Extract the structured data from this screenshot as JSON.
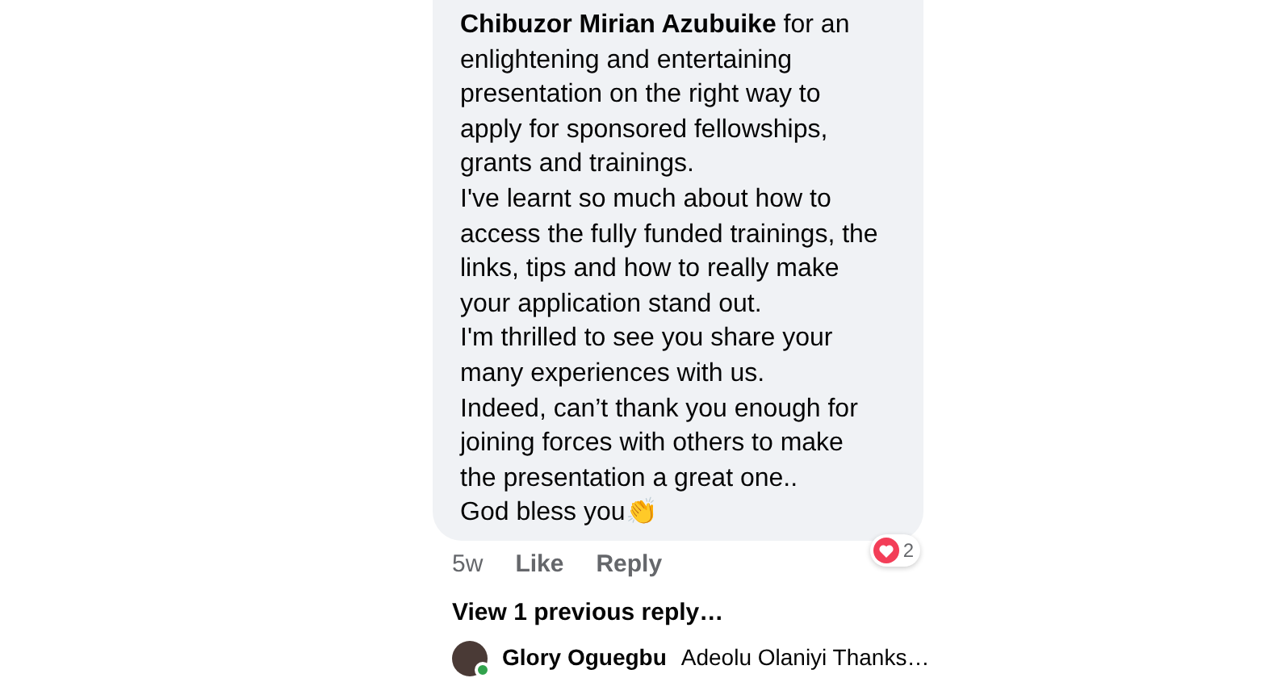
{
  "comment": {
    "text": "**Chibuzor Mirian Azubuike** for an\nenlightening and entertaining\npresentation on the right way to\napply for sponsored fellowships,\ngrants and trainings.\nI've learnt so much about how to\naccess the fully funded trainings, the\nlinks, tips and how to really make\nyour application stand out.\nI'm thrilled to see you share your\nmany experiences with us.\nIndeed, can’t thank you enough for\njoining forces with others to make\nthe presentation a great one..\nGod bless you👏",
    "time": "5w",
    "actions": [
      {
        "label": "Like"
      },
      {
        "label": "Reply"
      }
    ],
    "reaction_count": "2"
  },
  "view_replies": "View 1 previous reply…",
  "reply": {
    "author": "Glory Oguegbu",
    "text": "Adeolu Olaniyi Thanks…",
    "online": true
  }
}
